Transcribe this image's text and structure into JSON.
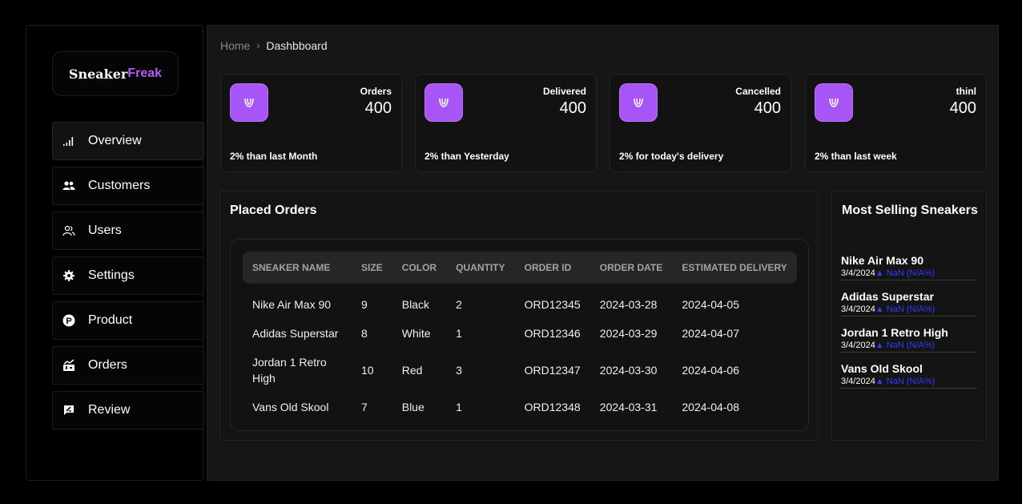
{
  "brand": {
    "part1": "Sneaker",
    "part2": "Freak"
  },
  "sidebar": {
    "items": [
      {
        "label": "Overview",
        "icon": "signal-bars-icon"
      },
      {
        "label": "Customers",
        "icon": "people-icon"
      },
      {
        "label": "Users",
        "icon": "users-outline-icon"
      },
      {
        "label": "Settings",
        "icon": "gear-icon"
      },
      {
        "label": "Product",
        "icon": "product-p-icon"
      },
      {
        "label": "Orders",
        "icon": "orders-chart-icon"
      },
      {
        "label": "Review",
        "icon": "review-icon"
      }
    ],
    "active": "Overview"
  },
  "breadcrumb": {
    "home": "Home",
    "separator": "›",
    "current": "Dashbboard"
  },
  "stats": [
    {
      "label": "Orders",
      "value": "400",
      "footer": "2% than last Month"
    },
    {
      "label": "Delivered",
      "value": "400",
      "footer": "2% than Yesterday"
    },
    {
      "label": "Cancelled",
      "value": "400",
      "footer": "2% for today's delivery"
    },
    {
      "label": "thinl",
      "value": "400",
      "footer": "2% than last week"
    }
  ],
  "orders": {
    "title": "Placed Orders",
    "columns": [
      "SNEAKER NAME",
      "SIZE",
      "COLOR",
      "QUANTITY",
      "ORDER ID",
      "ORDER DATE",
      "ESTIMATED DELIVERY"
    ],
    "rows": [
      [
        "Nike Air Max 90",
        "9",
        "Black",
        "2",
        "ORD12345",
        "2024-03-28",
        "2024-04-05"
      ],
      [
        "Adidas Superstar",
        "8",
        "White",
        "1",
        "ORD12346",
        "2024-03-29",
        "2024-04-07"
      ],
      [
        "Jordan 1 Retro High",
        "10",
        "Red",
        "3",
        "ORD12347",
        "2024-03-30",
        "2024-04-06"
      ],
      [
        "Vans Old Skool",
        "7",
        "Blue",
        "1",
        "ORD12348",
        "2024-03-31",
        "2024-04-08"
      ]
    ]
  },
  "most_selling": {
    "title": "Most Selling Sneakers",
    "items": [
      {
        "name": "Nike Air Max 90",
        "date": "3/4/2024",
        "change": "▲ NaN (N/A%)"
      },
      {
        "name": "Adidas Superstar",
        "date": "3/4/2024",
        "change": "▲ NaN (N/A%)"
      },
      {
        "name": "Jordan 1 Retro High",
        "date": "3/4/2024",
        "change": "▲ NaN (N/A%)"
      },
      {
        "name": "Vans Old Skool",
        "date": "3/4/2024",
        "change": "▲ NaN (N/A%)"
      }
    ]
  },
  "colors": {
    "accent": "#a855f7",
    "up": "#2f3bff",
    "background": "#000000",
    "panel": "#161616"
  }
}
